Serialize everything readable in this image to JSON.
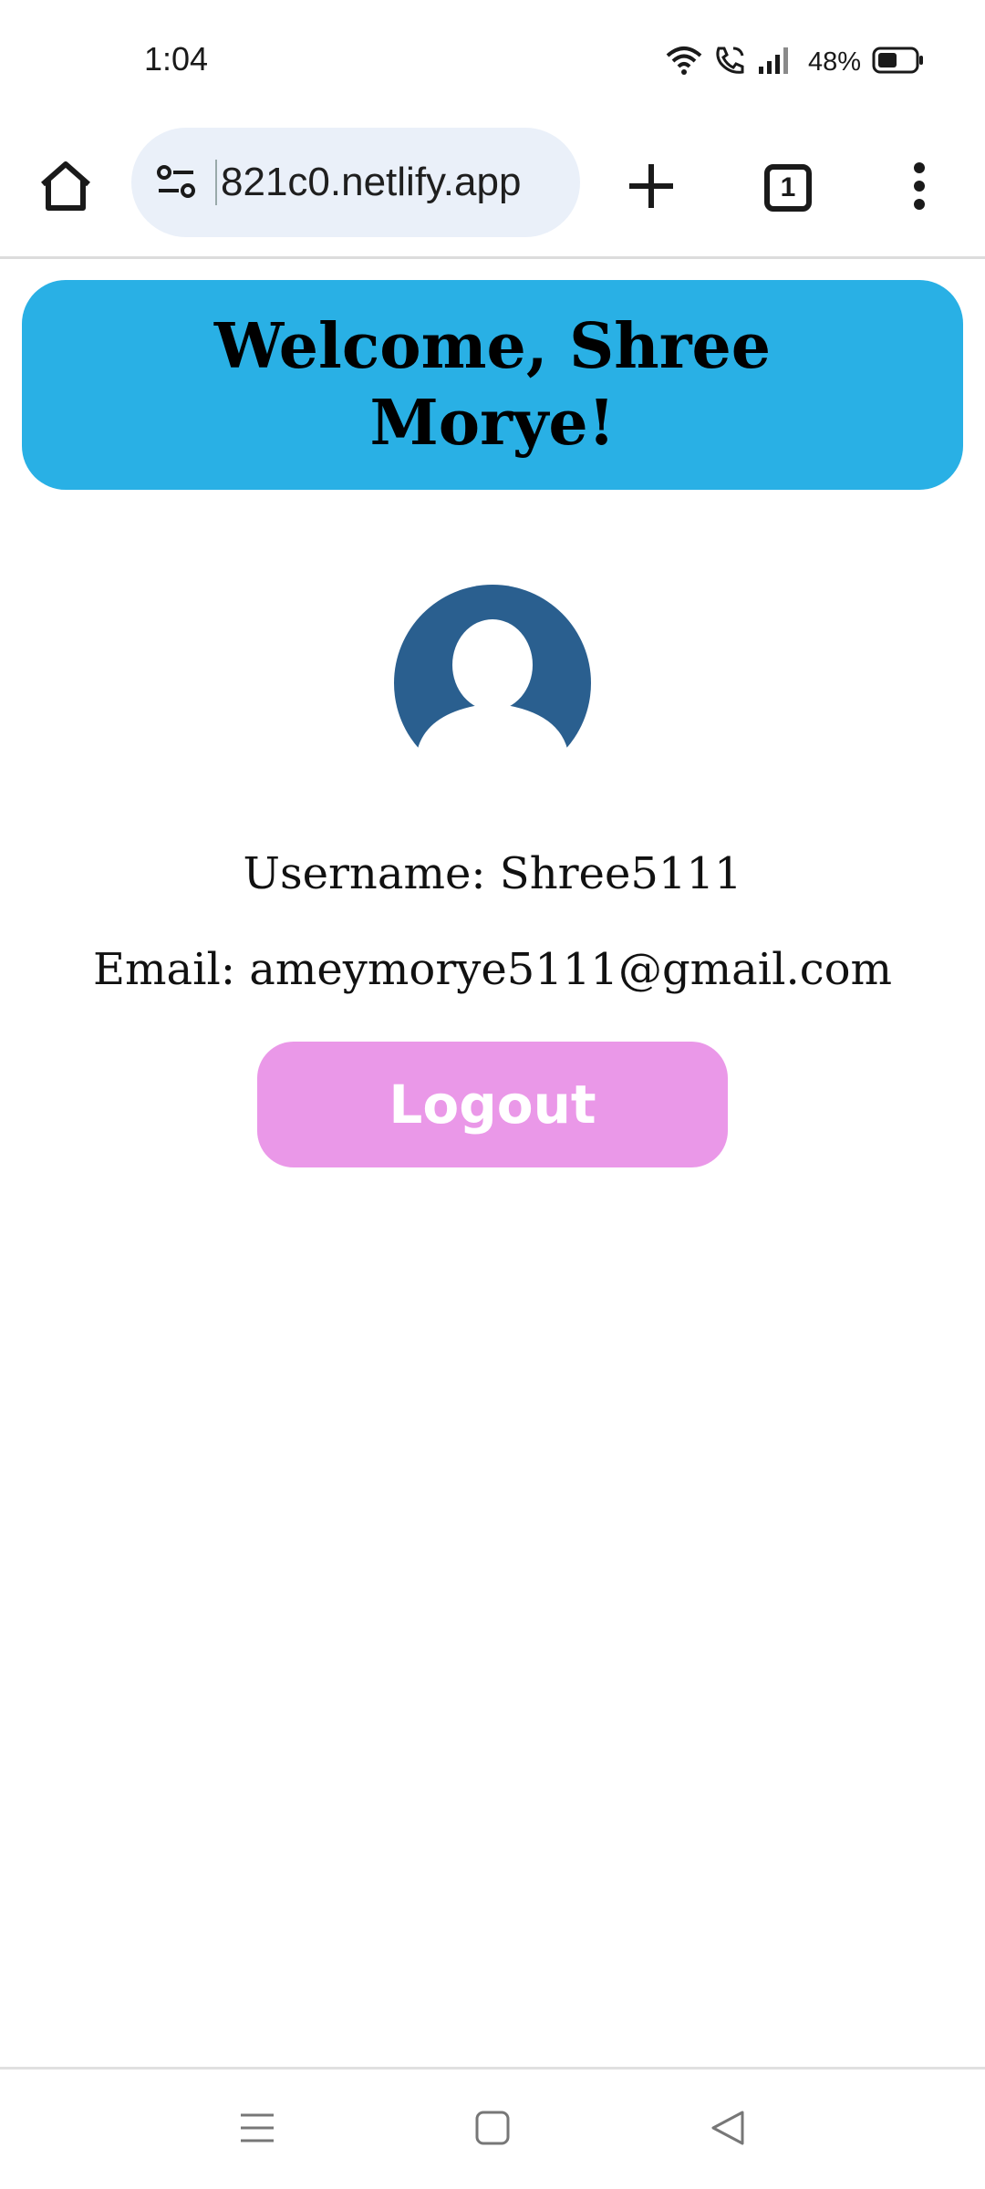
{
  "status_bar": {
    "time": "1:04",
    "battery_percent": "48%",
    "icons": [
      "wifi-icon",
      "wifi-calling-icon",
      "signal-icon",
      "battery-icon"
    ]
  },
  "browser": {
    "url": "821c0.netlify.app",
    "tab_count": "1",
    "icons": [
      "home-icon",
      "site-settings-icon",
      "new-tab-icon",
      "tabs-icon",
      "more-menu-icon"
    ]
  },
  "page": {
    "welcome_title": "Welcome, Shree Morye!",
    "username_line": "Username: Shree5111",
    "email_line": "Email: ameymorye5111@gmail.com",
    "logout_label": "Logout",
    "colors": {
      "banner": "#29b0e5",
      "avatar": "#2a5f8f",
      "logout_button": "#ea98e8"
    }
  },
  "nav_bar": {
    "icons": [
      "recents-icon",
      "home-nav-icon",
      "back-icon"
    ]
  }
}
